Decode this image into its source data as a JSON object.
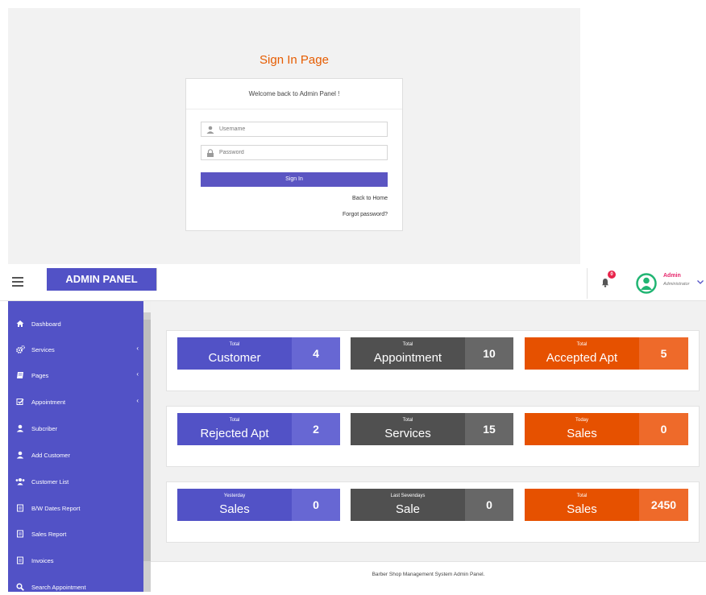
{
  "signin": {
    "title": "Sign In Page",
    "welcome": "Welcome back to Admin Panel !",
    "username_placeholder": "Username",
    "password_placeholder": "Password",
    "signin_button": "Sign In",
    "back_home": "Back to Home",
    "forgot": "Forgot password?"
  },
  "header": {
    "brand": "ADMIN PANEL",
    "notifications": "0",
    "user_name": "Admin",
    "user_role": "Administrator"
  },
  "sidebar": {
    "items": [
      {
        "label": "Dashboard",
        "icon": "home-icon"
      },
      {
        "label": "Services",
        "icon": "cogs-icon"
      },
      {
        "label": "Pages",
        "icon": "book-icon"
      },
      {
        "label": "Appointment",
        "icon": "check-square-icon"
      },
      {
        "label": "Subcriber",
        "icon": "user-icon"
      },
      {
        "label": "Add Customer",
        "icon": "user-icon"
      },
      {
        "label": "Customer List",
        "icon": "users-icon"
      },
      {
        "label": "B/W Dates Report",
        "icon": "file-icon"
      },
      {
        "label": "Sales Report",
        "icon": "file-icon"
      },
      {
        "label": "Invoices",
        "icon": "file-icon"
      },
      {
        "label": "Search Appointment",
        "icon": "search-icon"
      }
    ]
  },
  "stats": [
    [
      {
        "small": "Total",
        "big": "Customer",
        "value": "4",
        "color": "#5252c6"
      },
      {
        "small": "Total",
        "big": "Appointment",
        "value": "10",
        "color": "#505050"
      },
      {
        "small": "Total",
        "big": "Accepted Apt",
        "value": "5",
        "color": "#e65100"
      }
    ],
    [
      {
        "small": "Total",
        "big": "Rejected Apt",
        "value": "2",
        "color": "#5252c6"
      },
      {
        "small": "Total",
        "big": "Services",
        "value": "15",
        "color": "#505050"
      },
      {
        "small": "Today",
        "big": "Sales",
        "value": "0",
        "color": "#e65100"
      }
    ],
    [
      {
        "small": "Yesterday",
        "big": "Sales",
        "value": "0",
        "color": "#5252c6"
      },
      {
        "small": "Last Sevendays",
        "big": "Sale",
        "value": "0",
        "color": "#505050"
      },
      {
        "small": "Total",
        "big": "Sales",
        "value": "2450",
        "color": "#e65100"
      }
    ]
  ],
  "footer": "Barber Shop Management System Admin Panel."
}
